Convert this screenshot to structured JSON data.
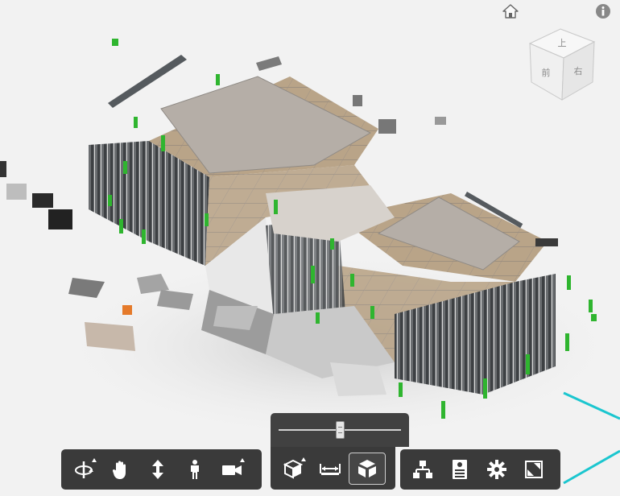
{
  "viewcube": {
    "top_label": "上",
    "front_label": "前",
    "right_label": "右"
  },
  "icons": {
    "home": "home-icon",
    "info": "info-icon",
    "orbit": "orbit-icon",
    "pan": "hand-icon",
    "zoom": "zoom-vertical-arrows-icon",
    "first_person": "person-icon",
    "camera": "camera-icon",
    "section": "section-box-icon",
    "measure": "measure-icon",
    "explode": "explode-cube-icon",
    "model_browser": "tree-icon",
    "properties": "properties-icon",
    "settings": "gear-icon",
    "fullscreen": "fullscreen-icon"
  },
  "slider": {
    "value_fraction": 0.5
  },
  "colors": {
    "toolbar_bg": "#3a3a3a",
    "background": "#f2f2f2",
    "floor_tan": "#b7a38a",
    "roof_gray": "#b5aea7",
    "wall_dark": "#5e6164",
    "element_green": "#2fb52f",
    "accent_cyan": "#1bc6cf",
    "accent_orange": "#e57a2a"
  }
}
